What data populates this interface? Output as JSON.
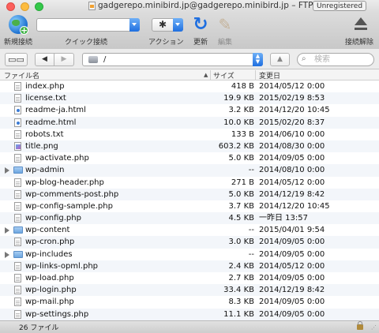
{
  "window": {
    "title": "gadgerepo.minibird.jp@gadgerepo.minibird.jp – FTP",
    "badge": "Unregistered"
  },
  "toolbar": {
    "new_connection_label": "新規接続",
    "quick_connect_label": "クイック接続",
    "action_label": "アクション",
    "refresh_label": "更新",
    "edit_label": "編集",
    "disconnect_label": "接続解除"
  },
  "navbar": {
    "path": "/",
    "search_placeholder": "検索"
  },
  "columns": {
    "name": "ファイル名",
    "size": "サイズ",
    "modified": "変更日"
  },
  "files": [
    {
      "name": "index.php",
      "size": "418 B",
      "date": "2014/05/12 0:00",
      "kind": "file"
    },
    {
      "name": "license.txt",
      "size": "19.9 KB",
      "date": "2015/02/19 8:53",
      "kind": "file"
    },
    {
      "name": "readme-ja.html",
      "size": "3.2 KB",
      "date": "2014/12/20 10:45",
      "kind": "html"
    },
    {
      "name": "readme.html",
      "size": "10.0 KB",
      "date": "2015/02/20 8:37",
      "kind": "html"
    },
    {
      "name": "robots.txt",
      "size": "133 B",
      "date": "2014/06/10 0:00",
      "kind": "file"
    },
    {
      "name": "title.png",
      "size": "603.2 KB",
      "date": "2014/08/30 0:00",
      "kind": "image"
    },
    {
      "name": "wp-activate.php",
      "size": "5.0 KB",
      "date": "2014/09/05 0:00",
      "kind": "file"
    },
    {
      "name": "wp-admin",
      "size": "--",
      "date": "2014/08/10 0:00",
      "kind": "folder"
    },
    {
      "name": "wp-blog-header.php",
      "size": "271 B",
      "date": "2014/05/12 0:00",
      "kind": "file"
    },
    {
      "name": "wp-comments-post.php",
      "size": "5.0 KB",
      "date": "2014/12/19 8:42",
      "kind": "file"
    },
    {
      "name": "wp-config-sample.php",
      "size": "3.7 KB",
      "date": "2014/12/20 10:45",
      "kind": "file"
    },
    {
      "name": "wp-config.php",
      "size": "4.5 KB",
      "date": "一昨日 13:57",
      "kind": "file"
    },
    {
      "name": "wp-content",
      "size": "--",
      "date": "2015/04/01 9:54",
      "kind": "folder"
    },
    {
      "name": "wp-cron.php",
      "size": "3.0 KB",
      "date": "2014/09/05 0:00",
      "kind": "file"
    },
    {
      "name": "wp-includes",
      "size": "--",
      "date": "2014/09/05 0:00",
      "kind": "folder"
    },
    {
      "name": "wp-links-opml.php",
      "size": "2.4 KB",
      "date": "2014/05/12 0:00",
      "kind": "file"
    },
    {
      "name": "wp-load.php",
      "size": "2.7 KB",
      "date": "2014/09/05 0:00",
      "kind": "file"
    },
    {
      "name": "wp-login.php",
      "size": "33.4 KB",
      "date": "2014/12/19 8:42",
      "kind": "file"
    },
    {
      "name": "wp-mail.php",
      "size": "8.3 KB",
      "date": "2014/09/05 0:00",
      "kind": "file"
    },
    {
      "name": "wp-settings.php",
      "size": "11.1 KB",
      "date": "2014/09/05 0:00",
      "kind": "file"
    }
  ],
  "status": {
    "count": "26 ファイル"
  }
}
